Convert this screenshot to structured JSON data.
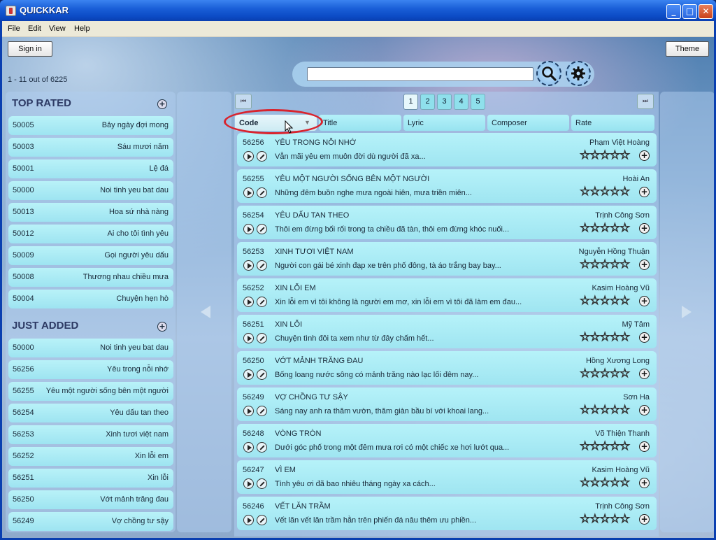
{
  "window": {
    "title": "QUICKKAR"
  },
  "menu": [
    "File",
    "Edit",
    "View",
    "Help"
  ],
  "toolbar": {
    "sign_in": "Sign in",
    "theme": "Theme",
    "count": "1 - 11 out of 6225"
  },
  "search": {
    "value": "",
    "placeholder": ""
  },
  "top_rated": {
    "title": "TOP RATED",
    "items": [
      {
        "code": "50005",
        "name": "Bảy ngày đợi mong"
      },
      {
        "code": "50003",
        "name": "Sáu mươi năm"
      },
      {
        "code": "50001",
        "name": "Lệ đá"
      },
      {
        "code": "50000",
        "name": "Noi tinh yeu bat dau"
      },
      {
        "code": "50013",
        "name": "Hoa sứ nhà nàng"
      },
      {
        "code": "50012",
        "name": "Ai cho tôi tình yêu"
      },
      {
        "code": "50009",
        "name": "Gọi người yêu dấu"
      },
      {
        "code": "50008",
        "name": "Thương nhau chiều mưa"
      },
      {
        "code": "50004",
        "name": "Chuyện hẹn hò"
      }
    ]
  },
  "just_added": {
    "title": "JUST ADDED",
    "items": [
      {
        "code": "50000",
        "name": "Noi tinh yeu bat dau"
      },
      {
        "code": "56256",
        "name": "Yêu trong nỗi nhớ"
      },
      {
        "code": "56255",
        "name": "Yêu một người sống bên một người"
      },
      {
        "code": "56254",
        "name": "Yêu dấu tan theo"
      },
      {
        "code": "56253",
        "name": "Xinh tươi việt nam"
      },
      {
        "code": "56252",
        "name": "Xin lỗi em"
      },
      {
        "code": "56251",
        "name": "Xin lỗi"
      },
      {
        "code": "56250",
        "name": "Vớt mảnh trăng đau"
      },
      {
        "code": "56249",
        "name": "Vợ chồng tư sậy"
      }
    ]
  },
  "pagination": {
    "pages": [
      "1",
      "2",
      "3",
      "4",
      "5"
    ],
    "active": "1",
    "first_icon": "first-page-icon",
    "last_icon": "last-page-icon"
  },
  "columns": [
    "Code",
    "Title",
    "Lyric",
    "Composer",
    "Rate"
  ],
  "songs": [
    {
      "code": "56256",
      "title": "YÊU TRONG NỖI NHỚ",
      "composer": "Phạm Việt Hoàng",
      "lyric": "Vẫn mãi yêu em muôn đời dù người đã xa..."
    },
    {
      "code": "56255",
      "title": "YÊU MỘT NGƯỜI SỐNG BÊN MỘT NGƯỜI",
      "composer": "Hoài An",
      "lyric": "Những đêm buồn nghe mưa ngoài hiên, mưa triền miên..."
    },
    {
      "code": "56254",
      "title": "YÊU DẤU TAN THEO",
      "composer": "Trịnh Công Sơn",
      "lyric": "Thôi em đừng bối rối trong ta chiều đã tàn, thôi em đừng khóc nuối..."
    },
    {
      "code": "56253",
      "title": "XINH TƯƠI VIỆT NAM",
      "composer": "Nguyễn Hồng Thuận",
      "lyric": "Người con gái bé xinh đạp xe trên phố đông, tà áo trắng bay bay..."
    },
    {
      "code": "56252",
      "title": "XIN LỖI EM",
      "composer": "Kasim Hoàng Vũ",
      "lyric": "Xin lỗi em vì tôi không là người em mơ, xin lỗi em vì tôi đã làm em đau..."
    },
    {
      "code": "56251",
      "title": "XIN LỖI",
      "composer": "Mỹ Tâm",
      "lyric": "Chuyện tình đôi ta xem như từ đây chấm hết..."
    },
    {
      "code": "56250",
      "title": "VỚT MẢNH TRĂNG ĐAU",
      "composer": "Hồng Xương Long",
      "lyric": "Bống loang nước sông có mảnh trăng nào lạc lối đêm nay..."
    },
    {
      "code": "56249",
      "title": "VỢ CHỒNG TƯ SẬY",
      "composer": "Sơn Ha",
      "lyric": "Sáng nay anh ra thăm vườn, thăm giàn bầu bí với khoai lang..."
    },
    {
      "code": "56248",
      "title": "VÒNG TRÒN",
      "composer": "Võ Thiện Thanh",
      "lyric": "Dưới góc phố trong một đêm mưa rơi có một chiếc xe hơi lướt qua..."
    },
    {
      "code": "56247",
      "title": "VÌ EM",
      "composer": "Kasim Hoàng Vũ",
      "lyric": "Tình yêu ơi đã bao nhiêu tháng ngày xa cách..."
    },
    {
      "code": "56246",
      "title": "VẾT LĂN TRẦM",
      "composer": "Trịnh Công Sơn",
      "lyric": "Vết lăn vết lăn trầm hằn trên phiến đá nâu thêm ưu phiền..."
    }
  ],
  "rating_stars": "☆☆☆☆☆",
  "add_glyph": "+",
  "colors": {
    "titlebar": "#0b4ac4",
    "row_bg": "#9fe5f1",
    "highlight": "#d9232d"
  }
}
